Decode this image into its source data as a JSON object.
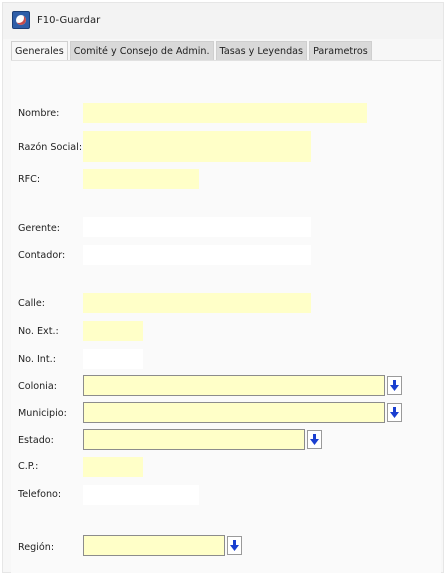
{
  "window": {
    "title": "F10-Guardar"
  },
  "tabs": [
    {
      "label": "Generales"
    },
    {
      "label": "Comité y Consejo de Admin."
    },
    {
      "label": "Tasas y Leyendas"
    },
    {
      "label": "Parametros"
    }
  ],
  "form": {
    "nombre": {
      "label": "Nombre:",
      "value": ""
    },
    "razon_social": {
      "label": "Razón Social:",
      "value": ""
    },
    "rfc": {
      "label": "RFC:",
      "value": ""
    },
    "gerente": {
      "label": "Gerente:",
      "value": ""
    },
    "contador": {
      "label": "Contador:",
      "value": ""
    },
    "calle": {
      "label": "Calle:",
      "value": ""
    },
    "no_ext": {
      "label": "No. Ext.:",
      "value": ""
    },
    "no_int": {
      "label": "No. Int.:",
      "value": ""
    },
    "colonia": {
      "label": "Colonia:",
      "value": ""
    },
    "municipio": {
      "label": "Municipio:",
      "value": ""
    },
    "estado": {
      "label": "Estado:",
      "value": ""
    },
    "cp": {
      "label": "C.P.:",
      "value": ""
    },
    "telefono": {
      "label": "Telefono:",
      "value": ""
    },
    "region": {
      "label": "Región:",
      "value": ""
    }
  },
  "colors": {
    "required_field": "#ffffc8",
    "dropdown_arrow": "#1a3fd0"
  },
  "icons": {
    "app": "app-logo-icon",
    "dropdown": "arrow-down-icon"
  }
}
